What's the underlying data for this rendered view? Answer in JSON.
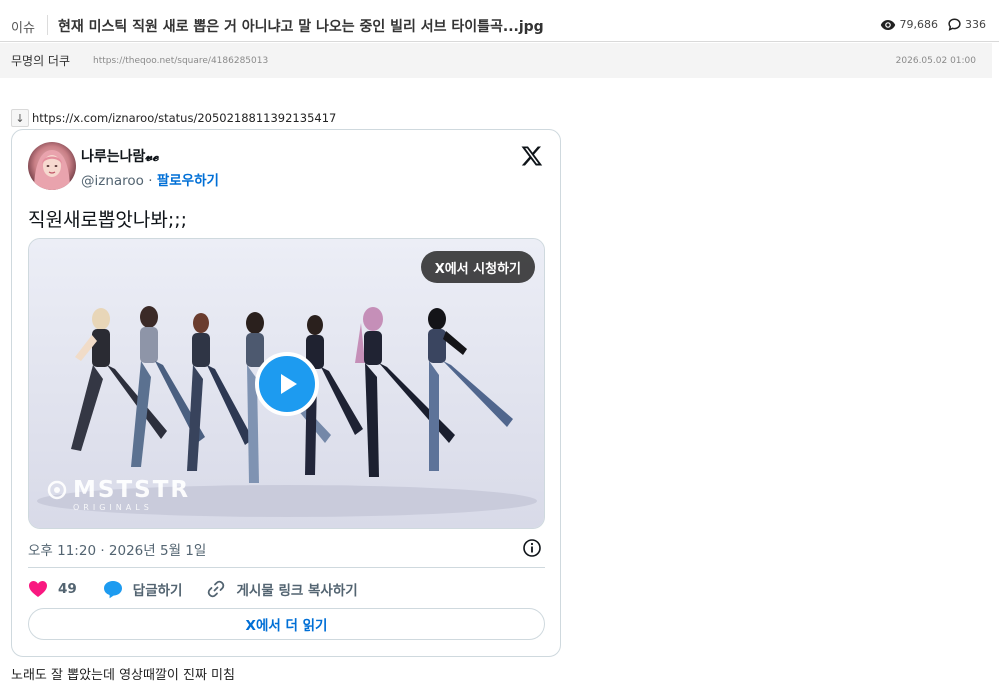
{
  "header": {
    "category": "이슈",
    "title": "현재 미스틱 직원 새로 뽑은 거 아니냐고 말 나오는 중인 빌리 서브 타이틀곡...jpg",
    "views": "79,686",
    "comments": "336",
    "icons": {
      "views": "eye-icon",
      "comments": "comment-bubble-icon"
    }
  },
  "meta": {
    "author": "무명의 더쿠",
    "url": "https://theqoo.net/square/4186285013",
    "date": "2026.05.02 01:00"
  },
  "link": {
    "arrow": "↓",
    "url": "https://x.com/iznaroo/status/2050218811392135417"
  },
  "tweet": {
    "display_name": "나루는나람𝓿𝓮",
    "handle": "@iznaroo",
    "separator": "·",
    "follow_label": "팔로우하기",
    "text": "직원새로뽑앗나봐;;;",
    "media": {
      "watch_label": "X에서 시청하기",
      "brand": "MSTSTR",
      "brand_sub": "ORIGINALS"
    },
    "time": "오후 11:20 · 2026년 5월 1일",
    "likes": "49",
    "reply_label": "답글하기",
    "copy_link_label": "게시물 링크 복사하기",
    "read_more_label": "X에서 더 읽기",
    "colors": {
      "like": "#f91880",
      "reply": "#1d9bf0",
      "link": "#006fd6"
    }
  },
  "comment": {
    "text": "노래도 잘 뽑았는데 영상때깔이 진짜 미침"
  }
}
